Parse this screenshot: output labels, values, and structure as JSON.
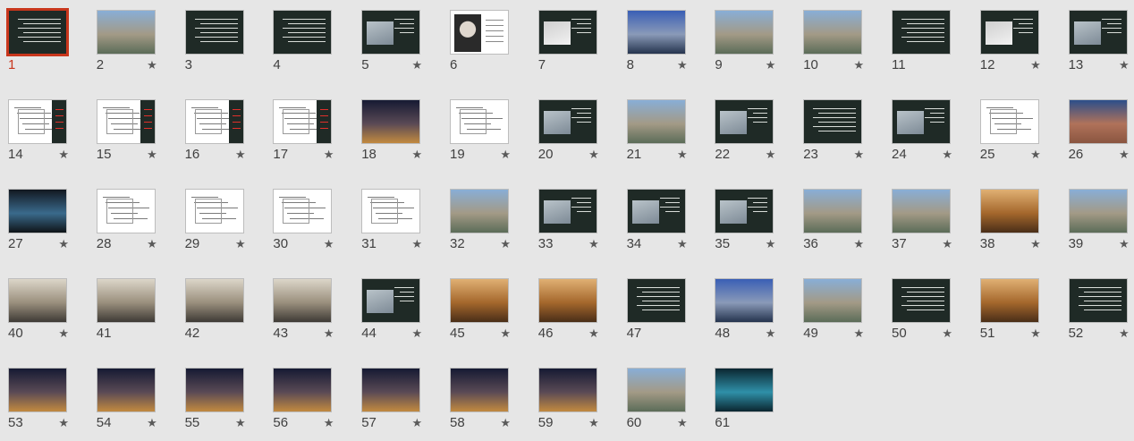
{
  "app": {
    "view": "Slide Sorter"
  },
  "selected_slide": "1",
  "transition_icon": "star-icon",
  "star_glyph": "★",
  "colors": {
    "selection": "#c8361c",
    "dark_slide": "#1f2a26",
    "background": "#e6e6e6"
  },
  "slides": [
    {
      "number": "1",
      "kind": "dark",
      "star": false
    },
    {
      "number": "2",
      "kind": "photo",
      "star": true
    },
    {
      "number": "3",
      "kind": "dark",
      "star": false
    },
    {
      "number": "4",
      "kind": "dark",
      "star": false
    },
    {
      "number": "5",
      "kind": "darkphoto",
      "star": true
    },
    {
      "number": "6",
      "kind": "portrait",
      "star": false
    },
    {
      "number": "7",
      "kind": "darksketch",
      "star": false
    },
    {
      "number": "8",
      "kind": "photo-blue",
      "star": true
    },
    {
      "number": "9",
      "kind": "photo",
      "star": true
    },
    {
      "number": "10",
      "kind": "photo",
      "star": true
    },
    {
      "number": "11",
      "kind": "dark",
      "star": false
    },
    {
      "number": "12",
      "kind": "darksketch",
      "star": true
    },
    {
      "number": "13",
      "kind": "darkphoto",
      "star": true
    },
    {
      "number": "14",
      "kind": "plan",
      "star": true
    },
    {
      "number": "15",
      "kind": "plan",
      "star": true
    },
    {
      "number": "16",
      "kind": "plan",
      "star": true
    },
    {
      "number": "17",
      "kind": "plan",
      "star": true
    },
    {
      "number": "18",
      "kind": "photo-night",
      "star": true
    },
    {
      "number": "19",
      "kind": "sketch",
      "star": true
    },
    {
      "number": "20",
      "kind": "darkphoto",
      "star": true
    },
    {
      "number": "21",
      "kind": "photo",
      "star": true
    },
    {
      "number": "22",
      "kind": "darkphoto",
      "star": true
    },
    {
      "number": "23",
      "kind": "dark",
      "star": true
    },
    {
      "number": "24",
      "kind": "darkphoto",
      "star": true
    },
    {
      "number": "25",
      "kind": "sketch",
      "star": true
    },
    {
      "number": "26",
      "kind": "photo-city",
      "star": true
    },
    {
      "number": "27",
      "kind": "model3d",
      "star": true
    },
    {
      "number": "28",
      "kind": "sketch",
      "star": true
    },
    {
      "number": "29",
      "kind": "sketch",
      "star": true
    },
    {
      "number": "30",
      "kind": "sketch",
      "star": true
    },
    {
      "number": "31",
      "kind": "sketch",
      "star": true
    },
    {
      "number": "32",
      "kind": "photo",
      "star": true
    },
    {
      "number": "33",
      "kind": "darkphoto",
      "star": true
    },
    {
      "number": "34",
      "kind": "darkphoto",
      "star": true
    },
    {
      "number": "35",
      "kind": "darkphoto",
      "star": true
    },
    {
      "number": "36",
      "kind": "photo",
      "star": true
    },
    {
      "number": "37",
      "kind": "photo",
      "star": true
    },
    {
      "number": "38",
      "kind": "photo-warm",
      "star": true
    },
    {
      "number": "39",
      "kind": "photo",
      "star": true
    },
    {
      "number": "40",
      "kind": "photo-interior",
      "star": true
    },
    {
      "number": "41",
      "kind": "photo-interior",
      "star": false
    },
    {
      "number": "42",
      "kind": "photo-interior",
      "star": false
    },
    {
      "number": "43",
      "kind": "photo-interior",
      "star": true
    },
    {
      "number": "44",
      "kind": "darkphoto",
      "star": true
    },
    {
      "number": "45",
      "kind": "photo-warm",
      "star": true
    },
    {
      "number": "46",
      "kind": "photo-warm",
      "star": true
    },
    {
      "number": "47",
      "kind": "dark",
      "star": false
    },
    {
      "number": "48",
      "kind": "photo-blue",
      "star": true
    },
    {
      "number": "49",
      "kind": "photo",
      "star": true
    },
    {
      "number": "50",
      "kind": "dark",
      "star": true
    },
    {
      "number": "51",
      "kind": "photo-warm",
      "star": true
    },
    {
      "number": "52",
      "kind": "dark",
      "star": true
    },
    {
      "number": "53",
      "kind": "photo-night",
      "star": true
    },
    {
      "number": "54",
      "kind": "photo-night",
      "star": true
    },
    {
      "number": "55",
      "kind": "photo-night",
      "star": true
    },
    {
      "number": "56",
      "kind": "photo-night",
      "star": true
    },
    {
      "number": "57",
      "kind": "photo-night",
      "star": true
    },
    {
      "number": "58",
      "kind": "photo-night",
      "star": true
    },
    {
      "number": "59",
      "kind": "photo-night",
      "star": true
    },
    {
      "number": "60",
      "kind": "photo",
      "star": true
    },
    {
      "number": "61",
      "kind": "photo-teal",
      "star": false
    }
  ]
}
